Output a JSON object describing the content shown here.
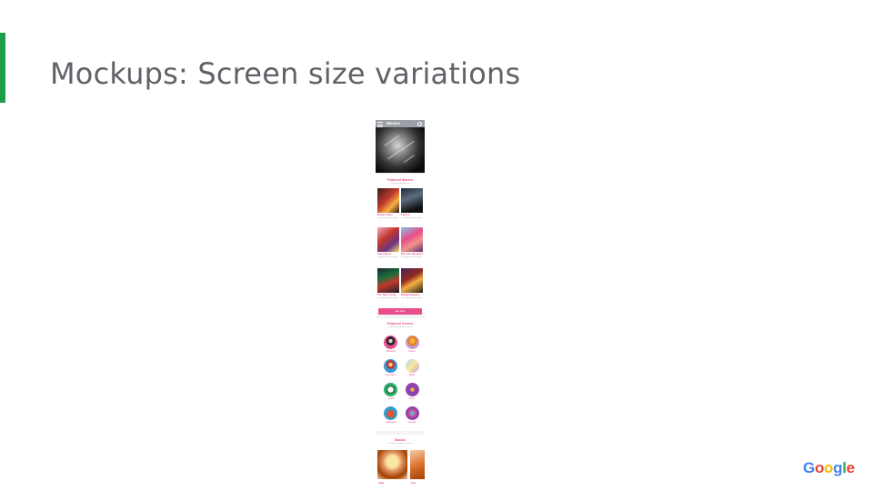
{
  "slide": {
    "title": "Mockups: Screen size variations"
  },
  "brand": {
    "logo_text": "Google",
    "accent_color": "#1e9e4a"
  },
  "phone": {
    "app_bar": {
      "title": "Movies",
      "menu_icon": "menu-icon",
      "search_icon": "search-icon"
    },
    "featured_movies": {
      "title": "Featured Movies",
      "subtitle": "Lorem ipsum dolor sit",
      "movies": [
        {
          "title": "Broken Sabre",
          "sub": "Lorem ipsum dolor sit amet"
        },
        {
          "title": "Catch It",
          "sub": "Lorem ipsum dolor sit amet"
        },
        {
          "title": "Glass Blood",
          "sub": "Lorem ipsum dolor sit amet"
        },
        {
          "title": "Dan, Him Revelation",
          "sub": "Lorem ipsum dolor sit amet"
        },
        {
          "title": "The Tiger's Hold",
          "sub": "Lorem ipsum dolor sit amet"
        },
        {
          "title": "Rollage Dangers",
          "sub": "Lorem ipsum dolor sit amet"
        }
      ],
      "see_more": "See More"
    },
    "featured_genres": {
      "title": "Featured Genres",
      "subtitle": "Lorem ipsum dolor sit amet",
      "genres": [
        {
          "label": "Romantic"
        },
        {
          "label": "Drama"
        },
        {
          "label": "Spy Agent"
        },
        {
          "label": "Magic"
        },
        {
          "label": "Sports"
        },
        {
          "label": "Action"
        },
        {
          "label": "Adventure"
        },
        {
          "label": "Comedy"
        }
      ]
    },
    "snacks": {
      "title": "Snacks",
      "subtitle": "Lorem ipsum dolor sit amet",
      "items": [
        {
          "label": "Chips"
        },
        {
          "label": "Fries"
        }
      ]
    },
    "colors": {
      "primary_pink": "#e84e8a",
      "app_bar_gray": "#9aa0a6"
    }
  }
}
